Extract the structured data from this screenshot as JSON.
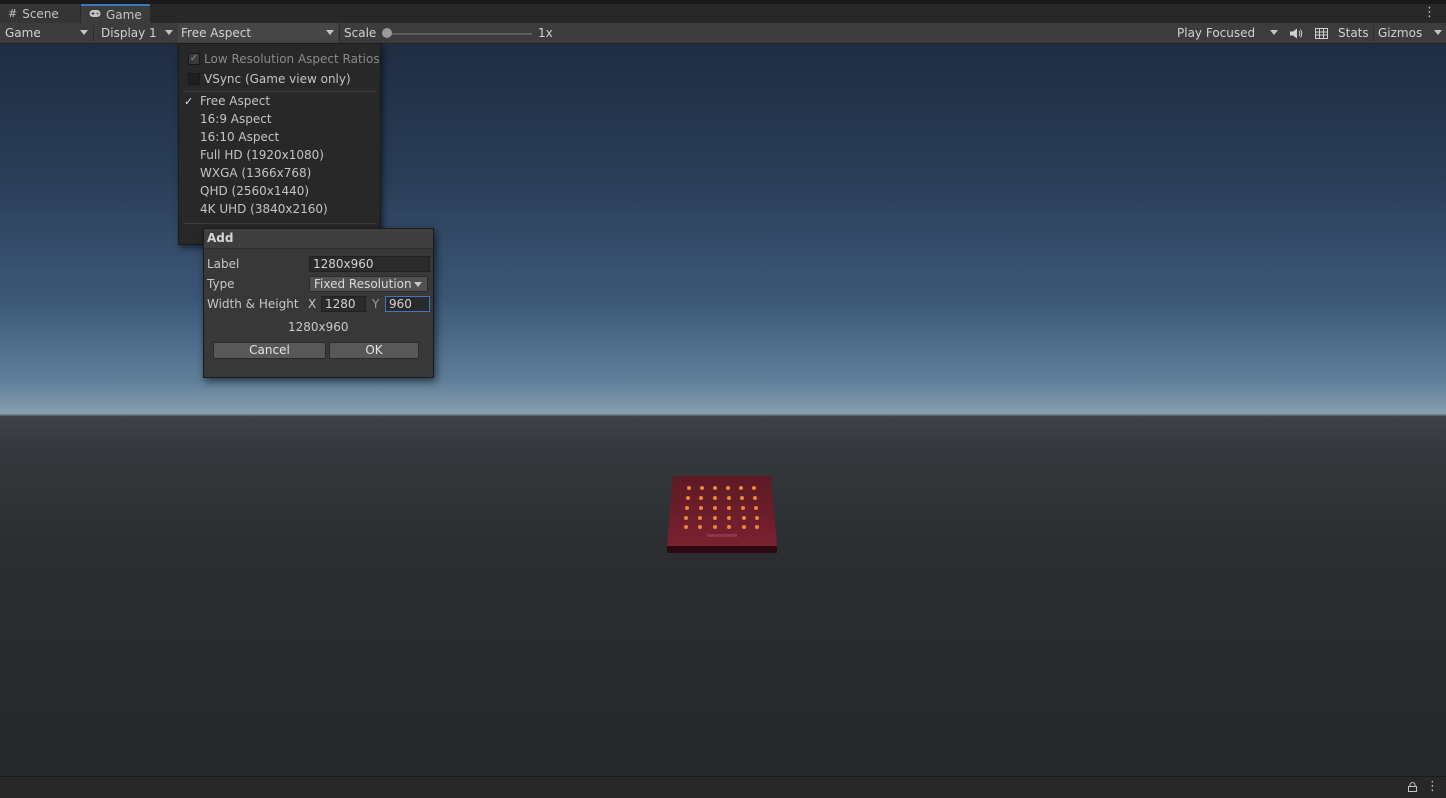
{
  "tabs": [
    {
      "label": "Scene",
      "icon": "grid-icon"
    },
    {
      "label": "Game",
      "icon": "gamepad-icon"
    }
  ],
  "toolbar": {
    "view_select": "Game",
    "display_select": "Display 1",
    "aspect_select": "Free Aspect",
    "scale_label": "Scale",
    "scale_value": "1x",
    "play_mode_select": "Play Focused",
    "stats_label": "Stats",
    "gizmos_label": "Gizmos"
  },
  "aspect_menu": {
    "low_res_label": "Low Resolution Aspect Ratios",
    "low_res_checked": true,
    "vsync_label": "VSync (Game view only)",
    "vsync_checked": false,
    "items": [
      {
        "label": "Free Aspect",
        "selected": true
      },
      {
        "label": "16:9 Aspect",
        "selected": false
      },
      {
        "label": "16:10 Aspect",
        "selected": false
      },
      {
        "label": "Full HD (1920x1080)",
        "selected": false
      },
      {
        "label": "WXGA (1366x768)",
        "selected": false
      },
      {
        "label": "QHD (2560x1440)",
        "selected": false
      },
      {
        "label": "4K UHD (3840x2160)",
        "selected": false
      }
    ]
  },
  "add_dialog": {
    "title": "Add",
    "label_caption": "Label",
    "label_value": "1280x960",
    "type_caption": "Type",
    "type_value": "Fixed Resolution",
    "size_caption": "Width & Height",
    "x_caption": "X",
    "x_value": "1280",
    "y_caption": "Y",
    "y_value": "960",
    "preview": "1280x960",
    "cancel_label": "Cancel",
    "ok_label": "OK"
  }
}
